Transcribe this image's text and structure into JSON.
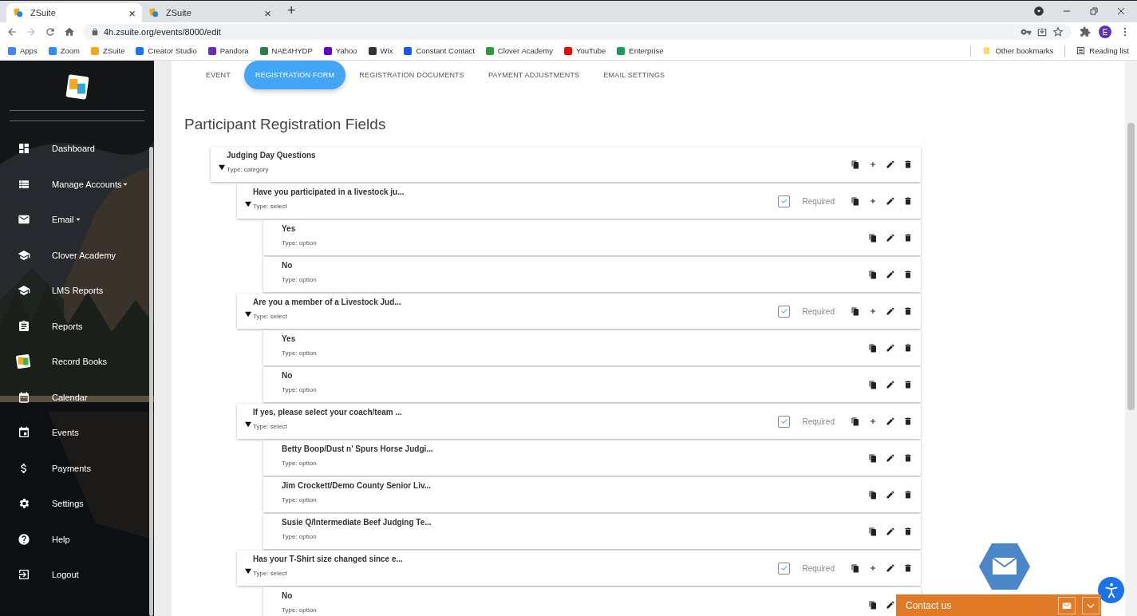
{
  "browser": {
    "tabs": [
      {
        "title": "ZSuite",
        "selected": true,
        "close": "×"
      },
      {
        "title": "ZSuite",
        "selected": false,
        "close": "×"
      }
    ],
    "new_tab": "+",
    "address": "4h.zsuite.org/events/8000/edit",
    "profile": "E",
    "bookmarks": [
      {
        "label": "Apps",
        "color": "#4285f4"
      },
      {
        "label": "Zoom",
        "color": "#2d8cff"
      },
      {
        "label": "ZSuite",
        "color": "#f4a81d"
      },
      {
        "label": "Creator Studio",
        "color": "#1877f2"
      },
      {
        "label": "Pandora",
        "color": "#6b2bbd"
      },
      {
        "label": "NAE4HYDP",
        "color": "#2f7d4a"
      },
      {
        "label": "Yahoo",
        "color": "#6001d2"
      },
      {
        "label": "Wix",
        "color": "#333333"
      },
      {
        "label": "Constant Contact",
        "color": "#1856ed"
      },
      {
        "label": "Clover Academy",
        "color": "#2e9a3a"
      },
      {
        "label": "YouTube",
        "color": "#ff0000"
      },
      {
        "label": "Enterprise",
        "color": "#169d5a"
      }
    ],
    "other_bookmarks": "Other bookmarks",
    "reading_list": "Reading list"
  },
  "sidebar": {
    "items": [
      {
        "label": "Dashboard",
        "submenu": false
      },
      {
        "label": "Manage Accounts",
        "submenu": true
      },
      {
        "label": "Email",
        "submenu": true
      },
      {
        "label": "Clover Academy",
        "submenu": false
      },
      {
        "label": "LMS Reports",
        "submenu": false
      },
      {
        "label": "Reports",
        "submenu": false
      },
      {
        "label": "Record Books",
        "submenu": false
      },
      {
        "label": "Calendar",
        "submenu": false
      },
      {
        "label": "Events",
        "submenu": false
      },
      {
        "label": "Payments",
        "submenu": false
      },
      {
        "label": "Settings",
        "submenu": false
      },
      {
        "label": "Help",
        "submenu": false
      },
      {
        "label": "Logout",
        "submenu": false
      }
    ]
  },
  "page_tabs": [
    {
      "label": "EVENT",
      "selected": false
    },
    {
      "label": "REGISTRATION FORM",
      "selected": true
    },
    {
      "label": "REGISTRATION DOCUMENTS",
      "selected": false
    },
    {
      "label": "PAYMENT ADJUSTMENTS",
      "selected": false
    },
    {
      "label": "EMAIL SETTINGS",
      "selected": false
    }
  ],
  "heading": "Participant Registration Fields",
  "fields": [
    {
      "kind": "category",
      "title": "Judging Day Questions",
      "type": "Type: category",
      "expanded": true,
      "children": [
        {
          "kind": "question",
          "title": "Have you participated in a livestock ju...",
          "type": "Type: select",
          "expanded": true,
          "required": true,
          "required_label": "Required",
          "children": [
            {
              "kind": "option",
              "title": "Yes",
              "type": "Type: option"
            },
            {
              "kind": "option",
              "title": "No",
              "type": "Type: option"
            }
          ]
        },
        {
          "kind": "question",
          "title": "Are you a member of a Livestock Jud...",
          "type": "Type: select",
          "expanded": true,
          "required": true,
          "required_label": "Required",
          "children": [
            {
              "kind": "option",
              "title": "Yes",
              "type": "Type: option"
            },
            {
              "kind": "option",
              "title": "No",
              "type": "Type: option"
            }
          ]
        },
        {
          "kind": "question",
          "title": "If yes, please select your coach/team ...",
          "type": "Type: select",
          "expanded": true,
          "required": true,
          "required_label": "Required",
          "children": [
            {
              "kind": "option",
              "title": "Betty Boop/Dust n' Spurs Horse Judgi...",
              "type": "Type: option"
            },
            {
              "kind": "option",
              "title": "Jim Crockett/Demo County Senior Liv...",
              "type": "Type: option"
            },
            {
              "kind": "option",
              "title": "Susie Q/Intermediate Beef Judging Te...",
              "type": "Type: option"
            }
          ]
        },
        {
          "kind": "question",
          "title": "Has your T-Shirt size changed since e...",
          "type": "Type: select",
          "expanded": true,
          "required": true,
          "required_label": "Required",
          "children": [
            {
              "kind": "option",
              "title": "No",
              "type": "Type: option"
            }
          ]
        }
      ]
    }
  ],
  "contact": {
    "label": "Contact us"
  }
}
